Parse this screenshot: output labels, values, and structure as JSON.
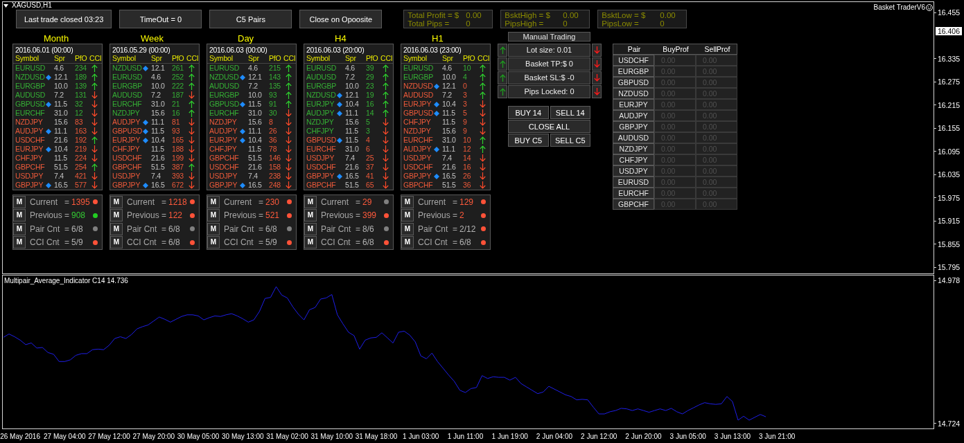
{
  "window": {
    "symbol": "XAGUSD,H1",
    "title": "Basket TraderV6"
  },
  "top_buttons": [
    "Last trade closed 03:23",
    "TimeOut = 0",
    "C5 Pairs",
    "Close on Opoosite"
  ],
  "stat_boxes": [
    {
      "lines": [
        {
          "label": "Total Profit = $",
          "value": "0.00"
        },
        {
          "label": "Total Pips =",
          "value": "0"
        }
      ]
    },
    {
      "lines": [
        {
          "label": "BsktHigh = $",
          "value": "0.00"
        },
        {
          "label": "PipsHigh =",
          "value": "0"
        }
      ]
    },
    {
      "lines": [
        {
          "label": "BsktLow = $",
          "value": "0.00"
        },
        {
          "label": "PipsLow =",
          "value": "0"
        }
      ]
    }
  ],
  "timeframes": [
    {
      "title": "Month",
      "date": "2016.06.01 (00:00)",
      "columns": [
        "Symbol",
        "Spr",
        "PfO",
        "CCI"
      ],
      "rows": [
        {
          "symbol": "EURUSD",
          "marked": false,
          "spread": "4.6",
          "pfo": "234",
          "cci_rising": true,
          "color": "#35b035"
        },
        {
          "symbol": "NZDUSD",
          "marked": true,
          "spread": "12.1",
          "pfo": "189",
          "cci_rising": true,
          "color": "#35b035"
        },
        {
          "symbol": "EURGBP",
          "marked": false,
          "spread": "10.0",
          "pfo": "139",
          "cci_rising": true,
          "color": "#35b035"
        },
        {
          "symbol": "AUDUSD",
          "marked": false,
          "spread": "7.2",
          "pfo": "131",
          "cci_rising": false,
          "color": "#35b035"
        },
        {
          "symbol": "GBPUSD",
          "marked": true,
          "spread": "11.5",
          "pfo": "32",
          "cci_rising": false,
          "color": "#35b035"
        },
        {
          "symbol": "EURCHF",
          "marked": false,
          "spread": "31.0",
          "pfo": "12",
          "cci_rising": false,
          "color": "#35b035"
        },
        {
          "symbol": "NZDJPY",
          "marked": false,
          "spread": "15.6",
          "pfo": "83",
          "cci_rising": false,
          "color": "#ee5a3a"
        },
        {
          "symbol": "AUDJPY",
          "marked": true,
          "spread": "11.1",
          "pfo": "163",
          "cci_rising": false,
          "color": "#ee5a3a"
        },
        {
          "symbol": "USDCHF",
          "marked": false,
          "spread": "21.6",
          "pfo": "192",
          "cci_rising": true,
          "color": "#ee5a3a"
        },
        {
          "symbol": "EURJPY",
          "marked": true,
          "spread": "10.4",
          "pfo": "219",
          "cci_rising": false,
          "color": "#ee5a3a"
        },
        {
          "symbol": "CHFJPY",
          "marked": false,
          "spread": "11.5",
          "pfo": "224",
          "cci_rising": false,
          "color": "#ee5a3a"
        },
        {
          "symbol": "GBPCHF",
          "marked": false,
          "spread": "51.5",
          "pfo": "254",
          "cci_rising": true,
          "color": "#ee5a3a"
        },
        {
          "symbol": "USDJPY",
          "marked": false,
          "spread": "7.4",
          "pfo": "421",
          "cci_rising": false,
          "color": "#ee5a3a"
        },
        {
          "symbol": "GBPJPY",
          "marked": true,
          "spread": "16.5",
          "pfo": "577",
          "cci_rising": false,
          "color": "#ee5a3a"
        }
      ],
      "stats": [
        {
          "button": "M",
          "label": "Current",
          "equals": "=",
          "value": {
            "text": "1395",
            "color": "#ff5a3c"
          },
          "color": "#ff5238"
        },
        {
          "button": "M",
          "label": "Previous",
          "equals": "=",
          "value": {
            "text": "908",
            "color": "#33cc33"
          },
          "color": "#22cc22"
        },
        {
          "button": "M",
          "label": "Pair Cnt",
          "equals": "=",
          "value": {
            "text": "6/8",
            "color": "#b4b4b4"
          },
          "color": "#808080"
        },
        {
          "button": "M",
          "label": "CCI Cnt",
          "equals": "=",
          "value": {
            "text": "5/9",
            "color": "#b4b4b4"
          },
          "color": "#ff5238"
        }
      ]
    },
    {
      "title": "Week",
      "date": "2016.05.29 (00:00)",
      "columns": [
        "Symbol",
        "Spr",
        "PfO",
        "CCI"
      ],
      "rows": [
        {
          "symbol": "NZDUSD",
          "marked": true,
          "spread": "12.1",
          "pfo": "261",
          "cci_rising": true,
          "color": "#35b035"
        },
        {
          "symbol": "EURUSD",
          "marked": false,
          "spread": "4.6",
          "pfo": "252",
          "cci_rising": true,
          "color": "#35b035"
        },
        {
          "symbol": "EURGBP",
          "marked": false,
          "spread": "10.0",
          "pfo": "222",
          "cci_rising": true,
          "color": "#35b035"
        },
        {
          "symbol": "AUDUSD",
          "marked": false,
          "spread": "7.2",
          "pfo": "187",
          "cci_rising": false,
          "color": "#35b035"
        },
        {
          "symbol": "EURCHF",
          "marked": false,
          "spread": "31.0",
          "pfo": "21",
          "cci_rising": true,
          "color": "#35b035"
        },
        {
          "symbol": "NZDJPY",
          "marked": false,
          "spread": "15.6",
          "pfo": "16",
          "cci_rising": true,
          "color": "#35b035"
        },
        {
          "symbol": "AUDJPY",
          "marked": true,
          "spread": "11.1",
          "pfo": "81",
          "cci_rising": false,
          "color": "#ee5a3a"
        },
        {
          "symbol": "GBPUSD",
          "marked": true,
          "spread": "11.5",
          "pfo": "93",
          "cci_rising": false,
          "color": "#ee5a3a"
        },
        {
          "symbol": "EURJPY",
          "marked": true,
          "spread": "10.4",
          "pfo": "165",
          "cci_rising": false,
          "color": "#ee5a3a"
        },
        {
          "symbol": "CHFJPY",
          "marked": false,
          "spread": "11.5",
          "pfo": "188",
          "cci_rising": false,
          "color": "#ee5a3a"
        },
        {
          "symbol": "USDCHF",
          "marked": false,
          "spread": "21.6",
          "pfo": "199",
          "cci_rising": false,
          "color": "#ee5a3a"
        },
        {
          "symbol": "GBPCHF",
          "marked": false,
          "spread": "51.5",
          "pfo": "387",
          "cci_rising": true,
          "color": "#ee5a3a"
        },
        {
          "symbol": "USDJPY",
          "marked": false,
          "spread": "7.4",
          "pfo": "393",
          "cci_rising": false,
          "color": "#ee5a3a"
        },
        {
          "symbol": "GBPJPY",
          "marked": true,
          "spread": "16.5",
          "pfo": "672",
          "cci_rising": false,
          "color": "#ee5a3a"
        }
      ],
      "stats": [
        {
          "button": "M",
          "label": "Current",
          "equals": "=",
          "value": {
            "text": "1218",
            "color": "#ff5a3c"
          },
          "color": "#ff5238"
        },
        {
          "button": "M",
          "label": "Previous",
          "equals": "=",
          "value": {
            "text": "122",
            "color": "#ff5a3c"
          },
          "color": "#ff5238"
        },
        {
          "button": "M",
          "label": "Pair Cnt",
          "equals": "=",
          "value": {
            "text": "6/8",
            "color": "#b4b4b4"
          },
          "color": "#808080"
        },
        {
          "button": "M",
          "label": "CCI Cnt",
          "equals": "=",
          "value": {
            "text": "6/8",
            "color": "#b4b4b4"
          },
          "color": "#ff5238"
        }
      ]
    },
    {
      "title": "Day",
      "date": "2016.06.03 (00:00)",
      "columns": [
        "Symbol",
        "Spr",
        "PfO",
        "CCI"
      ],
      "rows": [
        {
          "symbol": "EURUSD",
          "marked": false,
          "spread": "4.6",
          "pfo": "215",
          "cci_rising": true,
          "color": "#35b035"
        },
        {
          "symbol": "NZDUSD",
          "marked": true,
          "spread": "12.1",
          "pfo": "143",
          "cci_rising": true,
          "color": "#35b035"
        },
        {
          "symbol": "AUDUSD",
          "marked": false,
          "spread": "7.2",
          "pfo": "135",
          "cci_rising": true,
          "color": "#35b035"
        },
        {
          "symbol": "EURGBP",
          "marked": false,
          "spread": "10.0",
          "pfo": "93",
          "cci_rising": true,
          "color": "#35b035"
        },
        {
          "symbol": "GBPUSD",
          "marked": true,
          "spread": "11.5",
          "pfo": "91",
          "cci_rising": true,
          "color": "#35b035"
        },
        {
          "symbol": "EURCHF",
          "marked": false,
          "spread": "31.0",
          "pfo": "30",
          "cci_rising": false,
          "color": "#35b035"
        },
        {
          "symbol": "NZDJPY",
          "marked": false,
          "spread": "15.6",
          "pfo": "8",
          "cci_rising": false,
          "color": "#ee5a3a"
        },
        {
          "symbol": "AUDJPY",
          "marked": true,
          "spread": "11.1",
          "pfo": "26",
          "cci_rising": false,
          "color": "#ee5a3a"
        },
        {
          "symbol": "EURJPY",
          "marked": true,
          "spread": "10.4",
          "pfo": "36",
          "cci_rising": false,
          "color": "#ee5a3a"
        },
        {
          "symbol": "CHFJPY",
          "marked": false,
          "spread": "11.5",
          "pfo": "78",
          "cci_rising": false,
          "color": "#ee5a3a"
        },
        {
          "symbol": "GBPCHF",
          "marked": false,
          "spread": "51.5",
          "pfo": "146",
          "cci_rising": false,
          "color": "#ee5a3a"
        },
        {
          "symbol": "USDCHF",
          "marked": false,
          "spread": "21.6",
          "pfo": "158",
          "cci_rising": false,
          "color": "#ee5a3a"
        },
        {
          "symbol": "USDJPY",
          "marked": false,
          "spread": "7.4",
          "pfo": "238",
          "cci_rising": false,
          "color": "#ee5a3a"
        },
        {
          "symbol": "GBPJPY",
          "marked": true,
          "spread": "16.5",
          "pfo": "248",
          "cci_rising": false,
          "color": "#ee5a3a"
        }
      ],
      "stats": [
        {
          "button": "M",
          "label": "Current",
          "equals": "=",
          "value": {
            "text": "230",
            "color": "#ff5a3c"
          },
          "color": "#ff5238"
        },
        {
          "button": "M",
          "label": "Previous",
          "equals": "=",
          "value": {
            "text": "521",
            "color": "#ff5a3c"
          },
          "color": "#ff5238"
        },
        {
          "button": "M",
          "label": "Pair Cnt",
          "equals": "=",
          "value": {
            "text": "6/8",
            "color": "#b4b4b4"
          },
          "color": "#808080"
        },
        {
          "button": "M",
          "label": "CCI Cnt",
          "equals": "=",
          "value": {
            "text": "5/9",
            "color": "#b4b4b4"
          },
          "color": "#ff5238"
        }
      ]
    },
    {
      "title": "H4",
      "date": "2016.06.03 (20:00)",
      "columns": [
        "Symbol",
        "Spr",
        "PfO",
        "CCI"
      ],
      "rows": [
        {
          "symbol": "EURUSD",
          "marked": false,
          "spread": "4.6",
          "pfo": "39",
          "cci_rising": true,
          "color": "#35b035"
        },
        {
          "symbol": "AUDUSD",
          "marked": false,
          "spread": "7.2",
          "pfo": "29",
          "cci_rising": true,
          "color": "#35b035"
        },
        {
          "symbol": "EURGBP",
          "marked": false,
          "spread": "10.0",
          "pfo": "23",
          "cci_rising": true,
          "color": "#35b035"
        },
        {
          "symbol": "NZDUSD",
          "marked": true,
          "spread": "12.1",
          "pfo": "19",
          "cci_rising": true,
          "color": "#35b035"
        },
        {
          "symbol": "EURJPY",
          "marked": true,
          "spread": "10.4",
          "pfo": "16",
          "cci_rising": true,
          "color": "#35b035"
        },
        {
          "symbol": "AUDJPY",
          "marked": true,
          "spread": "11.1",
          "pfo": "14",
          "cci_rising": true,
          "color": "#35b035"
        },
        {
          "symbol": "NZDJPY",
          "marked": false,
          "spread": "15.6",
          "pfo": "5",
          "cci_rising": false,
          "color": "#35b035"
        },
        {
          "symbol": "CHFJPY",
          "marked": false,
          "spread": "11.5",
          "pfo": "3",
          "cci_rising": false,
          "color": "#35b035"
        },
        {
          "symbol": "GBPUSD",
          "marked": true,
          "spread": "11.5",
          "pfo": "4",
          "cci_rising": false,
          "color": "#ee5a3a"
        },
        {
          "symbol": "EURCHF",
          "marked": false,
          "spread": "31.0",
          "pfo": "6",
          "cci_rising": false,
          "color": "#ee5a3a"
        },
        {
          "symbol": "USDJPY",
          "marked": false,
          "spread": "7.4",
          "pfo": "25",
          "cci_rising": false,
          "color": "#ee5a3a"
        },
        {
          "symbol": "USDCHF",
          "marked": false,
          "spread": "21.6",
          "pfo": "37",
          "cci_rising": false,
          "color": "#ee5a3a"
        },
        {
          "symbol": "GBPJPY",
          "marked": true,
          "spread": "16.5",
          "pfo": "41",
          "cci_rising": false,
          "color": "#ee5a3a"
        },
        {
          "symbol": "GBPCHF",
          "marked": false,
          "spread": "51.5",
          "pfo": "65",
          "cci_rising": false,
          "color": "#ee5a3a"
        }
      ],
      "stats": [
        {
          "button": "M",
          "label": "Current",
          "equals": "=",
          "value": {
            "text": "29",
            "color": "#ff5a3c"
          },
          "color": "#808080"
        },
        {
          "button": "M",
          "label": "Previous",
          "equals": "=",
          "value": {
            "text": "399",
            "color": "#ff5a3c"
          },
          "color": "#ff5238"
        },
        {
          "button": "M",
          "label": "Pair Cnt",
          "equals": "=",
          "value": {
            "text": "8/6",
            "color": "#b4b4b4"
          },
          "color": "#808080"
        },
        {
          "button": "M",
          "label": "CCI Cnt",
          "equals": "=",
          "value": {
            "text": "6/8",
            "color": "#b4b4b4"
          },
          "color": "#ff5238"
        }
      ]
    },
    {
      "title": "H1",
      "date": "2016.06.03 (23:00)",
      "columns": [
        "Symbol",
        "Spr",
        "PfO",
        "CCI"
      ],
      "rows": [
        {
          "symbol": "EURUSD",
          "marked": false,
          "spread": "4.6",
          "pfo": "10",
          "cci_rising": true,
          "color": "#35b035"
        },
        {
          "symbol": "EURGBP",
          "marked": false,
          "spread": "10.0",
          "pfo": "4",
          "cci_rising": true,
          "color": "#35b035"
        },
        {
          "symbol": "NZDUSD",
          "marked": true,
          "spread": "12.1",
          "pfo": "0",
          "cci_rising": true,
          "color": "#ee5a3a"
        },
        {
          "symbol": "AUDUSD",
          "marked": false,
          "spread": "7.2",
          "pfo": "3",
          "cci_rising": true,
          "color": "#ee5a3a"
        },
        {
          "symbol": "EURJPY",
          "marked": true,
          "spread": "10.4",
          "pfo": "3",
          "cci_rising": false,
          "color": "#ee5a3a"
        },
        {
          "symbol": "GBPUSD",
          "marked": true,
          "spread": "11.5",
          "pfo": "5",
          "cci_rising": false,
          "color": "#ee5a3a"
        },
        {
          "symbol": "CHFJPY",
          "marked": false,
          "spread": "11.5",
          "pfo": "9",
          "cci_rising": false,
          "color": "#ee5a3a"
        },
        {
          "symbol": "NZDJPY",
          "marked": false,
          "spread": "15.6",
          "pfo": "9",
          "cci_rising": false,
          "color": "#ee5a3a"
        },
        {
          "symbol": "EURCHF",
          "marked": false,
          "spread": "31.0",
          "pfo": "10",
          "cci_rising": true,
          "color": "#ee5a3a"
        },
        {
          "symbol": "AUDJPY",
          "marked": true,
          "spread": "11.1",
          "pfo": "12",
          "cci_rising": true,
          "color": "#ee5a3a"
        },
        {
          "symbol": "USDJPY",
          "marked": false,
          "spread": "7.4",
          "pfo": "14",
          "cci_rising": false,
          "color": "#ee5a3a"
        },
        {
          "symbol": "USDCHF",
          "marked": false,
          "spread": "21.6",
          "pfo": "16",
          "cci_rising": false,
          "color": "#ee5a3a"
        },
        {
          "symbol": "GBPJPY",
          "marked": true,
          "spread": "16.5",
          "pfo": "26",
          "cci_rising": false,
          "color": "#ee5a3a"
        },
        {
          "symbol": "GBPCHF",
          "marked": false,
          "spread": "51.5",
          "pfo": "36",
          "cci_rising": false,
          "color": "#ee5a3a"
        }
      ],
      "stats": [
        {
          "button": "M",
          "label": "Current",
          "equals": "=",
          "value": {
            "text": "129",
            "color": "#ff5a3c"
          },
          "color": "#ff5238"
        },
        {
          "button": "M",
          "label": "Previous",
          "equals": "=",
          "value": {
            "text": "2",
            "color": "#ff5a3c"
          },
          "color": "#ff5238"
        },
        {
          "button": "M",
          "label": "Pair Cnt",
          "equals": "=",
          "value": {
            "text": "2/12",
            "color": "#b4b4b4"
          },
          "color": "#ff5238"
        },
        {
          "button": "M",
          "label": "CCI Cnt",
          "equals": "=",
          "value": {
            "text": "6/8",
            "color": "#b4b4b4"
          },
          "color": "#ff5238"
        }
      ]
    }
  ],
  "manual_trading": {
    "title": "Manual Trading",
    "settings": [
      "Lot size: 0.01",
      "Basket TP:$ 0",
      "Basket SL:$ -0",
      "Pips Locked: 0"
    ],
    "action_rows": [
      [
        "BUY 14",
        "SELL 14"
      ],
      [
        "CLOSE ALL"
      ],
      [
        "BUY C5",
        "SELL C5"
      ]
    ]
  },
  "pair_table": {
    "columns": [
      "Pair",
      "BuyProf",
      "SellProf"
    ],
    "rows": [
      {
        "pair": "USDCHF",
        "buy_profit": "0.00",
        "sell_profit": "0.00"
      },
      {
        "pair": "EURGBP",
        "buy_profit": "0.00",
        "sell_profit": "0.00"
      },
      {
        "pair": "GBPUSD",
        "buy_profit": "0.00",
        "sell_profit": "0.00"
      },
      {
        "pair": "NZDUSD",
        "buy_profit": "0.00",
        "sell_profit": "0.00"
      },
      {
        "pair": "EURJPY",
        "buy_profit": "0.00",
        "sell_profit": "0.00"
      },
      {
        "pair": "AUDJPY",
        "buy_profit": "0.00",
        "sell_profit": "0.00"
      },
      {
        "pair": "GBPJPY",
        "buy_profit": "0.00",
        "sell_profit": "0.00"
      },
      {
        "pair": "AUDUSD",
        "buy_profit": "0.00",
        "sell_profit": "0.00"
      },
      {
        "pair": "NZDJPY",
        "buy_profit": "0.00",
        "sell_profit": "0.00"
      },
      {
        "pair": "CHFJPY",
        "buy_profit": "0.00",
        "sell_profit": "0.00"
      },
      {
        "pair": "USDJPY",
        "buy_profit": "0.00",
        "sell_profit": "0.00"
      },
      {
        "pair": "EURUSD",
        "buy_profit": "0.00",
        "sell_profit": "0.00"
      },
      {
        "pair": "EURCHF",
        "buy_profit": "0.00",
        "sell_profit": "0.00"
      },
      {
        "pair": "GBPCHF",
        "buy_profit": "0.00",
        "sell_profit": "0.00"
      }
    ]
  },
  "price_axis": {
    "ticks": [
      "16.455",
      "16.335",
      "16.275",
      "16.215",
      "16.155",
      "16.095",
      "16.035",
      "15.975",
      "15.915",
      "15.855",
      "15.795"
    ],
    "current_price": "16.406"
  },
  "indicator": {
    "label": "Multipair_Average_Indicator C14 14.736",
    "chart_data": {
      "type": "line",
      "ylim": [
        14.714,
        14.988
      ],
      "yticks": [
        {
          "value": 14.724,
          "label": "14.724"
        },
        {
          "value": 14.978,
          "label": "14.978"
        }
      ],
      "categories": [
        null,
        null,
        null,
        "26 May 2016",
        null,
        null,
        null,
        null,
        null,
        null,
        null,
        "27 May 04:00",
        null,
        null,
        null,
        null,
        null,
        null,
        null,
        "27 May 12:00",
        null,
        null,
        null,
        null,
        null,
        null,
        null,
        "27 May 20:00",
        null,
        null,
        null,
        null,
        null,
        null,
        null,
        "30 May 05:00",
        null,
        null,
        null,
        null,
        null,
        null,
        null,
        "30 May 13:00",
        null,
        null,
        null,
        null,
        null,
        null,
        null,
        "31 May 02:00",
        null,
        null,
        null,
        null,
        null,
        null,
        null,
        "31 May 10:00",
        null,
        null,
        null,
        null,
        null,
        null,
        null,
        "31 May 18:00",
        null,
        null,
        null,
        null,
        null,
        null,
        null,
        "1 Jun 03:00",
        null,
        null,
        null,
        null,
        null,
        null,
        null,
        "1 Jun 11:00",
        null,
        null,
        null,
        null,
        null,
        null,
        null,
        "1 Jun 19:00",
        null,
        null,
        null,
        null,
        null,
        null,
        null,
        "2 Jun 04:00",
        null,
        null,
        null,
        null,
        null,
        null,
        null,
        "2 Jun 12:00",
        null,
        null,
        null,
        null,
        null,
        null,
        null,
        "2 Jun 20:00",
        null,
        null,
        null,
        null,
        null,
        null,
        null,
        "3 Jun 05:00",
        null,
        null,
        null,
        null,
        null,
        null,
        null,
        "3 Jun 13:00",
        null,
        null,
        null,
        null,
        null,
        null,
        null,
        "3 Jun 21:00",
        null,
        null,
        null,
        null,
        null,
        null,
        null,
        null,
        null,
        null,
        null,
        null,
        null,
        null,
        null,
        null,
        null,
        null,
        null,
        null,
        null,
        null,
        null,
        null,
        null,
        null,
        null,
        null
      ],
      "series": [
        {
          "color": "#1e1ee6",
          "values": [
            14.877,
            14.883,
            14.878,
            14.872,
            14.864,
            14.867,
            14.858,
            14.859,
            14.85,
            14.847,
            14.834,
            14.834,
            14.837,
            14.845,
            14.848,
            14.848,
            14.855,
            14.856,
            14.855,
            14.863,
            14.875,
            14.878,
            14.875,
            14.882,
            14.892,
            14.896,
            14.899,
            14.906,
            14.913,
            14.909,
            14.904,
            14.909,
            14.914,
            14.917,
            14.917,
            14.915,
            14.908,
            14.912,
            14.915,
            14.914,
            14.917,
            14.919,
            14.915,
            14.91,
            14.904,
            14.908,
            14.923,
            14.946,
            14.948,
            14.967,
            14.952,
            14.947,
            14.931,
            14.918,
            14.908,
            14.926,
            14.93,
            14.945,
            14.947,
            14.953,
            14.917,
            14.901,
            14.886,
            14.88,
            14.856,
            14.872,
            14.876,
            14.877,
            14.885,
            14.876,
            14.867,
            14.886,
            14.888,
            14.881,
            14.869,
            14.844,
            14.839,
            14.849,
            14.834,
            14.822,
            14.81,
            14.799,
            14.783,
            14.779,
            14.786,
            14.788,
            14.809,
            14.804,
            14.807,
            14.806,
            14.806,
            14.801,
            14.806,
            14.795,
            14.789,
            14.783,
            14.777,
            14.78,
            14.79,
            14.785,
            14.78,
            14.775,
            14.772,
            14.766,
            14.767,
            14.766,
            14.753,
            14.741,
            14.741,
            14.745,
            14.747,
            14.751,
            14.75,
            14.747,
            14.75,
            14.747,
            14.744,
            14.747,
            14.75,
            14.747,
            14.751,
            14.745,
            14.741,
            14.747,
            14.752,
            14.757,
            14.761,
            14.759,
            14.758,
            14.759,
            14.772,
            14.763,
            14.73,
            14.737,
            14.73,
            14.735,
            14.74,
            14.736,
            null,
            null,
            null,
            null,
            null,
            null,
            null,
            null,
            null,
            null,
            null,
            null,
            null,
            null,
            null,
            null,
            null,
            null,
            null,
            null,
            null,
            null,
            null,
            null,
            null,
            null,
            null,
            null,
            null,
            null
          ]
        }
      ]
    }
  }
}
